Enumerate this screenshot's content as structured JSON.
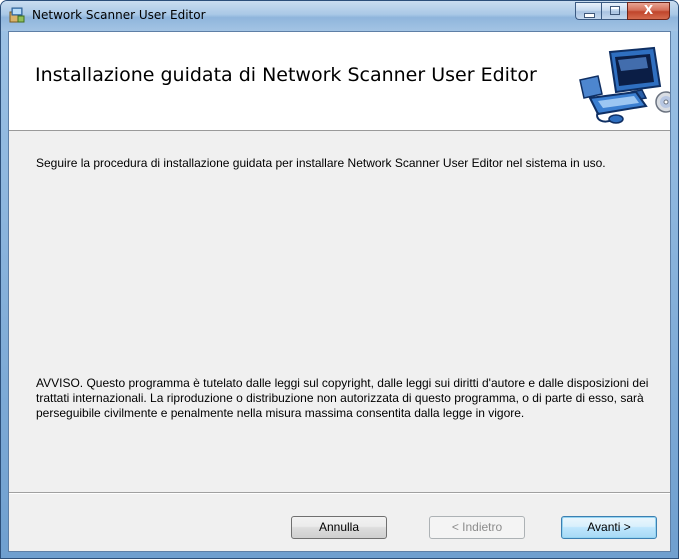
{
  "window": {
    "title": "Network Scanner User Editor",
    "icon": "installer-icon",
    "controls": {
      "minimize_icon": "minimize-icon",
      "maximize_icon": "maximize-icon",
      "close_label": "X"
    }
  },
  "banner": {
    "title": "Installazione guidata di Network Scanner User Editor",
    "graphic": "computer-setup-icon"
  },
  "body": {
    "intro": "Seguire la procedura di installazione guidata per installare Network Scanner User Editor nel sistema in uso.",
    "warning": "AVVISO. Questo programma è tutelato dalle leggi sul copyright, dalle leggi sui diritti d'autore e dalle disposizioni dei trattati internazionali. La riproduzione o distribuzione non autorizzata di questo programma, o di parte di esso, sarà perseguibile civilmente e penalmente nella misura massima consentita dalla legge in vigore."
  },
  "buttons": {
    "cancel": "Annulla",
    "back": "< Indietro",
    "next": "Avanti >"
  },
  "colors": {
    "titlebar": "#a9c8e6",
    "body_bg": "#f0f0f0",
    "default_button_border": "#3c7fb1"
  }
}
